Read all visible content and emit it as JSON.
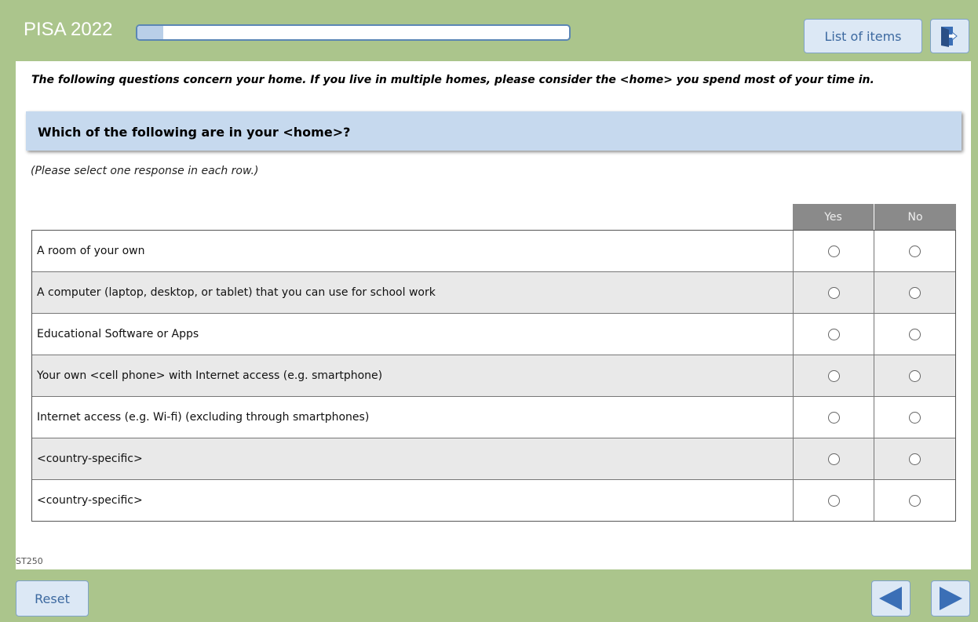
{
  "header": {
    "app_title": "PISA 2022",
    "progress_fraction": 0.06,
    "list_button_label": "List of items",
    "exit_icon": "exit-door-icon"
  },
  "content": {
    "intro": "The following questions concern your home. If you live in multiple homes, please consider the <home> you spend most of your time in.",
    "question": "Which of the following are in your <home>?",
    "instruction": "(Please select one response in each row.)",
    "columns": [
      "Yes",
      "No"
    ],
    "rows": [
      "A room of your own",
      "A computer (laptop, desktop, or tablet) that you can use for school work",
      "Educational Software or Apps",
      "Your own <cell phone> with Internet access (e.g. smartphone)",
      "Internet access (e.g. Wi-fi) (excluding through smartphones)",
      "<country-specific>",
      "<country-specific>"
    ],
    "item_code": "ST250"
  },
  "footer": {
    "reset_label": "Reset",
    "prev_icon": "arrow-left-icon",
    "next_icon": "arrow-right-icon"
  },
  "colors": {
    "frame_green": "#abc58c",
    "button_bg": "#dce8f5",
    "button_text": "#3c69a0",
    "question_bg": "#c6d9ee",
    "header_col_bg": "#8a8a8a",
    "alt_row_bg": "#e9e9e9",
    "arrow_blue": "#3b6fb6"
  }
}
